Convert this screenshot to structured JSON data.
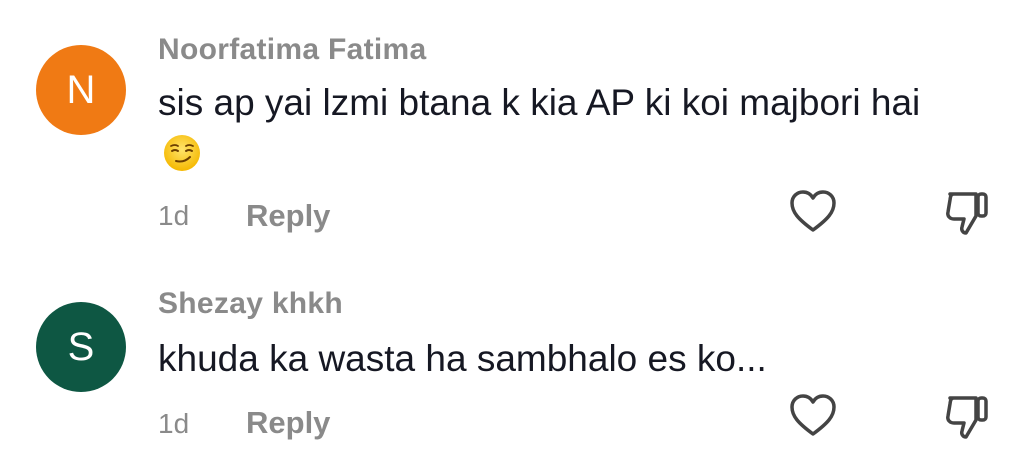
{
  "comments": [
    {
      "avatar_letter": "N",
      "avatar_color": "#F07A14",
      "username": "Noorfatima Fatima",
      "text": "sis ap yai lzmi btana k kia AP ki koi majbori hai",
      "emoji": "smirking-face-emoji",
      "time": "1d",
      "reply_label": "Reply"
    },
    {
      "avatar_letter": "S",
      "avatar_color": "#0E5743",
      "username": "Shezay khkh",
      "text": "khuda ka wasta ha sambhalo es ko...",
      "time": "1d",
      "reply_label": "Reply"
    }
  ],
  "icons": {
    "like": "heart-outline-icon",
    "dislike": "thumbs-down-outline-icon"
  }
}
